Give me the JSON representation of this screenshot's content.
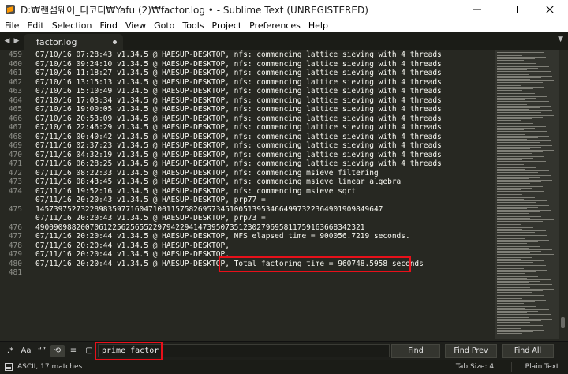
{
  "window": {
    "title": "D:₩랜섬웨어_디코더₩Yafu (2)₩factor.log • - Sublime Text (UNREGISTERED)"
  },
  "menu": [
    "File",
    "Edit",
    "Selection",
    "Find",
    "View",
    "Goto",
    "Tools",
    "Project",
    "Preferences",
    "Help"
  ],
  "tab": {
    "label": "factor.log"
  },
  "editor": {
    "lines": [
      {
        "num": "459",
        "text": "07/10/16 07:28:43 v1.34.5 @ HAESUP-DESKTOP, nfs: commencing lattice sieving with 4 threads"
      },
      {
        "num": "460",
        "text": "07/10/16 09:24:10 v1.34.5 @ HAESUP-DESKTOP, nfs: commencing lattice sieving with 4 threads"
      },
      {
        "num": "461",
        "text": "07/10/16 11:18:27 v1.34.5 @ HAESUP-DESKTOP, nfs: commencing lattice sieving with 4 threads"
      },
      {
        "num": "462",
        "text": "07/10/16 13:15:13 v1.34.5 @ HAESUP-DESKTOP, nfs: commencing lattice sieving with 4 threads"
      },
      {
        "num": "463",
        "text": "07/10/16 15:10:49 v1.34.5 @ HAESUP-DESKTOP, nfs: commencing lattice sieving with 4 threads"
      },
      {
        "num": "464",
        "text": "07/10/16 17:03:34 v1.34.5 @ HAESUP-DESKTOP, nfs: commencing lattice sieving with 4 threads"
      },
      {
        "num": "465",
        "text": "07/10/16 19:00:05 v1.34.5 @ HAESUP-DESKTOP, nfs: commencing lattice sieving with 4 threads"
      },
      {
        "num": "466",
        "text": "07/10/16 20:53:09 v1.34.5 @ HAESUP-DESKTOP, nfs: commencing lattice sieving with 4 threads"
      },
      {
        "num": "467",
        "text": "07/10/16 22:46:29 v1.34.5 @ HAESUP-DESKTOP, nfs: commencing lattice sieving with 4 threads"
      },
      {
        "num": "468",
        "text": "07/11/16 00:40:42 v1.34.5 @ HAESUP-DESKTOP, nfs: commencing lattice sieving with 4 threads"
      },
      {
        "num": "469",
        "text": "07/11/16 02:37:23 v1.34.5 @ HAESUP-DESKTOP, nfs: commencing lattice sieving with 4 threads"
      },
      {
        "num": "470",
        "text": "07/11/16 04:32:19 v1.34.5 @ HAESUP-DESKTOP, nfs: commencing lattice sieving with 4 threads"
      },
      {
        "num": "471",
        "text": "07/11/16 06:28:25 v1.34.5 @ HAESUP-DESKTOP, nfs: commencing lattice sieving with 4 threads"
      },
      {
        "num": "472",
        "text": "07/11/16 08:22:33 v1.34.5 @ HAESUP-DESKTOP, nfs: commencing msieve filtering"
      },
      {
        "num": "473",
        "text": "07/11/16 08:43:45 v1.34.5 @ HAESUP-DESKTOP, nfs: commencing msieve linear algebra"
      },
      {
        "num": "474",
        "text": "07/11/16 19:52:16 v1.34.5 @ HAESUP-DESKTOP, nfs: commencing msieve sqrt"
      },
      {
        "num": "",
        "text": "07/11/16 20:20:43 v1.34.5 @ HAESUP-DESKTOP, prp77 ="
      },
      {
        "num": "475",
        "text": "14573975273228983597716047100115758269573451005139534664997322364901909849647"
      },
      {
        "num": "",
        "text": "07/11/16 20:20:43 v1.34.5 @ HAESUP-DESKTOP, prp73 ="
      },
      {
        "num": "476",
        "text": "4900909882007061225625655229794229414739507351230279695811759163668342321"
      },
      {
        "num": "477",
        "text": "07/11/16 20:20:44 v1.34.5 @ HAESUP-DESKTOP, NFS elapsed time = 900056.7219 seconds."
      },
      {
        "num": "478",
        "text": "07/11/16 20:20:44 v1.34.5 @ HAESUP-DESKTOP,"
      },
      {
        "num": "479",
        "text": "07/11/16 20:20:44 v1.34.5 @ HAESUP-DESKTOP,"
      },
      {
        "num": "480",
        "text": "07/11/16 20:20:44 v1.34.5 @ HAESUP-DESKTOP, Total factoring time = 960748.5958 seconds"
      },
      {
        "num": "481",
        "text": ""
      }
    ]
  },
  "find": {
    "query": "prime factor",
    "options": [
      "regex-icon",
      "case-sensitive-icon",
      "whole-word-icon",
      "wrap-icon",
      "in-selection-icon",
      "highlight-matches-icon"
    ],
    "find_label": "Find",
    "find_prev_label": "Find Prev",
    "find_all_label": "Find All"
  },
  "status": {
    "encoding": "ASCII, 17 matches",
    "tab_size": "Tab Size: 4",
    "syntax": "Plain Text"
  },
  "colors": {
    "background": "#272822",
    "text": "#f8f8f2",
    "gutter": "#8f908a",
    "highlight_border": "#e8101a"
  }
}
